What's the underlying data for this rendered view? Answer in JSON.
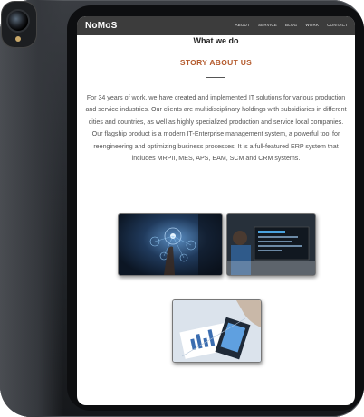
{
  "site": {
    "brand": "NoMoS",
    "nav": [
      "ABOUT",
      "SERVICE",
      "BLOG",
      "WORK",
      "CONTACT"
    ]
  },
  "section": {
    "title": "What we do",
    "story_title": "STORY ABOUT US",
    "story_text": "For 34 years of work, we have created and implemented IT solutions for various production and service industries. Our clients are multidisciplinary holdings with subsidiaries in different cities and countries, as well as highly specialized production and service local companies. Our flagship product is a modern IT-Enterprise management system, a powerful tool for reengineering and optimizing business processes. It is a full-featured ERP system that includes MRPII, MES, APS, EAM, SCM and CRM systems."
  },
  "colors": {
    "navbar": "#3c3c3c",
    "accent": "#b45a2c",
    "device": "#2b2e33"
  }
}
